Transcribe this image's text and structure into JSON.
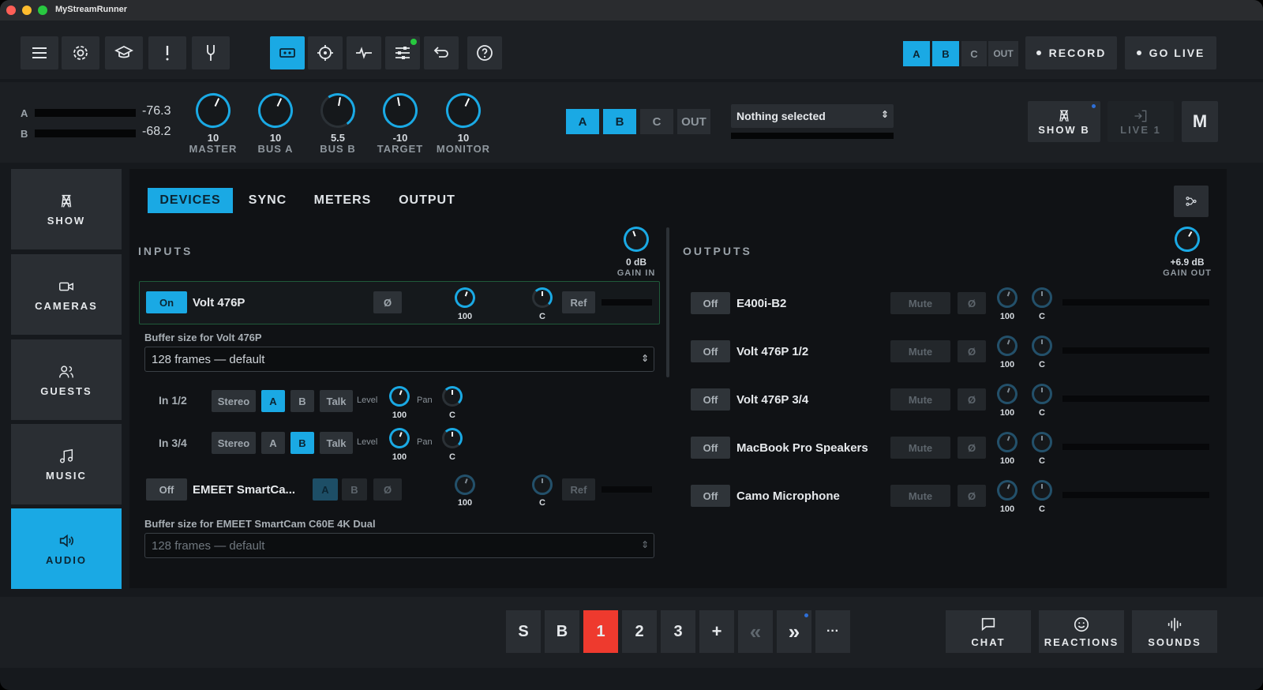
{
  "app": {
    "title": "MyStreamRunner"
  },
  "topbar": {
    "segments": [
      {
        "label": "A",
        "on": true
      },
      {
        "label": "B",
        "on": true
      },
      {
        "label": "C",
        "on": false
      },
      {
        "label": "OUT",
        "on": false
      }
    ],
    "record": "RECORD",
    "golive": "GO LIVE"
  },
  "meters": {
    "a": {
      "label": "A",
      "value": "-76.3"
    },
    "b": {
      "label": "B",
      "value": "-68.2"
    }
  },
  "knobs": [
    {
      "value": "10",
      "name": "MASTER"
    },
    {
      "value": "10",
      "name": "BUS A"
    },
    {
      "value": "5.5",
      "name": "BUS B"
    },
    {
      "value": "-10",
      "name": "TARGET"
    },
    {
      "value": "10",
      "name": "MONITOR"
    }
  ],
  "bus": {
    "segments": [
      "A",
      "B",
      "C",
      "OUT"
    ],
    "select": "Nothing selected"
  },
  "scene": {
    "show_b": "SHOW B",
    "live1": "LIVE 1",
    "m": "M"
  },
  "sidebar": {
    "items": [
      "SHOW",
      "CAMERAS",
      "GUESTS",
      "MUSIC",
      "AUDIO"
    ]
  },
  "tabs": [
    "DEVICES",
    "SYNC",
    "METERS",
    "OUTPUT"
  ],
  "inputs": {
    "heading": "INPUTS",
    "gain_value": "0 dB",
    "gain_label": "GAIN IN",
    "dev1": {
      "state": "On",
      "name": "Volt 476P",
      "phase": "Ø",
      "level": "100",
      "pan": "C",
      "ref": "Ref"
    },
    "buffer1_label": "Buffer size for Volt 476P",
    "buffer1_value": "128 frames — default",
    "channels": [
      {
        "name": "In 1/2",
        "stereo": "Stereo",
        "a": "A",
        "b": "B",
        "talk": "Talk",
        "level_label": "Level",
        "level": "100",
        "pan_label": "Pan",
        "pan": "C"
      },
      {
        "name": "In 3/4",
        "stereo": "Stereo",
        "a": "A",
        "b": "B",
        "talk": "Talk",
        "level_label": "Level",
        "level": "100",
        "pan_label": "Pan",
        "pan": "C"
      }
    ],
    "dev2": {
      "state": "Off",
      "name": "EMEET SmartCa...",
      "a": "A",
      "b": "B",
      "phase": "Ø",
      "level": "100",
      "pan": "C",
      "ref": "Ref"
    },
    "buffer2_label": "Buffer size for EMEET SmartCam C60E 4K Dual",
    "buffer2_value": "128 frames — default"
  },
  "outputs": {
    "heading": "OUTPUTS",
    "gain_value": "+6.9 dB",
    "gain_label": "GAIN OUT",
    "rows": [
      {
        "state": "Off",
        "name": "E400i-B2",
        "mute": "Mute",
        "phase": "Ø",
        "level": "100",
        "pan": "C"
      },
      {
        "state": "Off",
        "name": "Volt 476P 1/2",
        "mute": "Mute",
        "phase": "Ø",
        "level": "100",
        "pan": "C"
      },
      {
        "state": "Off",
        "name": "Volt 476P 3/4",
        "mute": "Mute",
        "phase": "Ø",
        "level": "100",
        "pan": "C"
      },
      {
        "state": "Off",
        "name": "MacBook Pro Speakers",
        "mute": "Mute",
        "phase": "Ø",
        "level": "100",
        "pan": "C"
      },
      {
        "state": "Off",
        "name": "Camo Microphone",
        "mute": "Mute",
        "phase": "Ø",
        "level": "100",
        "pan": "C"
      }
    ]
  },
  "bottom": {
    "buttons": [
      "S",
      "B",
      "1",
      "2",
      "3",
      "+",
      "«",
      "»",
      "···"
    ],
    "chat": "CHAT",
    "reactions": "REACTIONS",
    "sounds": "SOUNDS"
  },
  "colors": {
    "accent": "#1aa9e4",
    "live": "#ee3a2e",
    "status_dot": "#27c93f"
  }
}
